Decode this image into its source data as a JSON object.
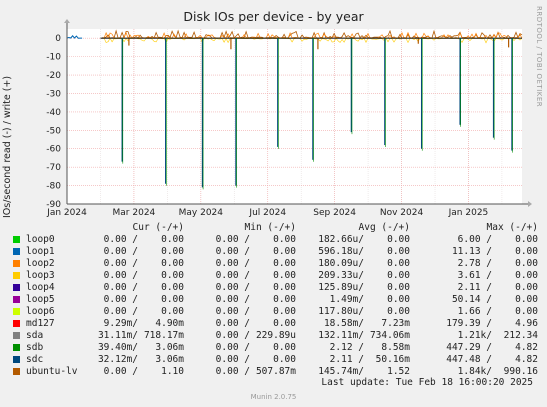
{
  "title": "Disk IOs per device - by year",
  "ylabel": "IOs/second read (-) / write (+)",
  "watermark": "RRDTOOL / TOBI OETIKER",
  "chart_data": {
    "type": "line",
    "title": "Disk IOs per device - by year",
    "ylabel": "IOs/second read (-) / write (+)",
    "xlabel": "",
    "ylim": [
      -90,
      5
    ],
    "yticks": [
      0,
      -10,
      -20,
      -30,
      -40,
      -50,
      -60,
      -70,
      -80,
      -90
    ],
    "xticks": [
      "Jan 2024",
      "Mar 2024",
      "May 2024",
      "Jul 2024",
      "Sep 2024",
      "Nov 2024",
      "Jan 2025"
    ],
    "xlim_months": [
      0,
      13.6
    ],
    "grid": true,
    "read_spikes": [
      {
        "month": 1.65,
        "value": -67
      },
      {
        "month": 2.95,
        "value": -79
      },
      {
        "month": 4.05,
        "value": -81
      },
      {
        "month": 5.05,
        "value": -80
      },
      {
        "month": 6.3,
        "value": -59
      },
      {
        "month": 7.35,
        "value": -66
      },
      {
        "month": 8.5,
        "value": -51
      },
      {
        "month": 9.5,
        "value": -58
      },
      {
        "month": 10.6,
        "value": -60
      },
      {
        "month": 11.75,
        "value": -47
      },
      {
        "month": 12.75,
        "value": -54
      },
      {
        "month": 13.3,
        "value": -61
      }
    ],
    "series": [
      {
        "name": "loop0",
        "color": "#00cc00"
      },
      {
        "name": "loop1",
        "color": "#0066b3"
      },
      {
        "name": "loop2",
        "color": "#ff8000"
      },
      {
        "name": "loop3",
        "color": "#ffcc00"
      },
      {
        "name": "loop4",
        "color": "#330099"
      },
      {
        "name": "loop5",
        "color": "#990099"
      },
      {
        "name": "loop6",
        "color": "#ccff00"
      },
      {
        "name": "md127",
        "color": "#ff0000"
      },
      {
        "name": "sda",
        "color": "#808080"
      },
      {
        "name": "sdb",
        "color": "#008f00"
      },
      {
        "name": "sdc",
        "color": "#00487d"
      },
      {
        "name": "ubuntu-lv",
        "color": "#b35a00"
      }
    ]
  },
  "legend": {
    "headers": {
      "cur": "Cur (-/+)",
      "min": "Min (-/+)",
      "avg": "Avg (-/+)",
      "max": "Max (-/+)"
    },
    "rows": [
      {
        "name": "loop0",
        "color": "#00cc00",
        "cur_r": "0.00 /",
        "cur_w": "0.00",
        "min_r": "0.00 /",
        "min_w": "0.00",
        "avg_r": "182.66u/",
        "avg_w": "0.00",
        "max_r": "6.00 /",
        "max_w": "0.00"
      },
      {
        "name": "loop1",
        "color": "#0066b3",
        "cur_r": "0.00 /",
        "cur_w": "0.00",
        "min_r": "0.00 /",
        "min_w": "0.00",
        "avg_r": "596.18u/",
        "avg_w": "0.00",
        "max_r": "11.13 /",
        "max_w": "0.00"
      },
      {
        "name": "loop2",
        "color": "#ff8000",
        "cur_r": "0.00 /",
        "cur_w": "0.00",
        "min_r": "0.00 /",
        "min_w": "0.00",
        "avg_r": "180.09u/",
        "avg_w": "0.00",
        "max_r": "2.78 /",
        "max_w": "0.00"
      },
      {
        "name": "loop3",
        "color": "#ffcc00",
        "cur_r": "0.00 /",
        "cur_w": "0.00",
        "min_r": "0.00 /",
        "min_w": "0.00",
        "avg_r": "209.33u/",
        "avg_w": "0.00",
        "max_r": "3.61 /",
        "max_w": "0.00"
      },
      {
        "name": "loop4",
        "color": "#330099",
        "cur_r": "0.00 /",
        "cur_w": "0.00",
        "min_r": "0.00 /",
        "min_w": "0.00",
        "avg_r": "125.89u/",
        "avg_w": "0.00",
        "max_r": "2.11 /",
        "max_w": "0.00"
      },
      {
        "name": "loop5",
        "color": "#990099",
        "cur_r": "0.00 /",
        "cur_w": "0.00",
        "min_r": "0.00 /",
        "min_w": "0.00",
        "avg_r": "1.49m/",
        "avg_w": "0.00",
        "max_r": "50.14 /",
        "max_w": "0.00"
      },
      {
        "name": "loop6",
        "color": "#ccff00",
        "cur_r": "0.00 /",
        "cur_w": "0.00",
        "min_r": "0.00 /",
        "min_w": "0.00",
        "avg_r": "117.80u/",
        "avg_w": "0.00",
        "max_r": "1.66 /",
        "max_w": "0.00"
      },
      {
        "name": "md127",
        "color": "#ff0000",
        "cur_r": "9.29m/",
        "cur_w": "4.90m",
        "min_r": "0.00 /",
        "min_w": "0.00",
        "avg_r": "18.58m/",
        "avg_w": "7.23m",
        "max_r": "179.39 /",
        "max_w": "4.96"
      },
      {
        "name": "sda",
        "color": "#808080",
        "cur_r": "31.11m/",
        "cur_w": "718.17m",
        "min_r": "0.00 /",
        "min_w": "229.89u",
        "avg_r": "132.11m/",
        "avg_w": "734.06m",
        "max_r": "1.21k/",
        "max_w": "212.34"
      },
      {
        "name": "sdb",
        "color": "#008f00",
        "cur_r": "39.40m/",
        "cur_w": "3.06m",
        "min_r": "0.00 /",
        "min_w": "0.00",
        "avg_r": "2.12 /",
        "avg_w": "8.58m",
        "max_r": "447.29 /",
        "max_w": "4.82"
      },
      {
        "name": "sdc",
        "color": "#00487d",
        "cur_r": "32.12m/",
        "cur_w": "3.06m",
        "min_r": "0.00 /",
        "min_w": "0.00",
        "avg_r": "2.11 /",
        "avg_w": "50.16m",
        "max_r": "447.48 /",
        "max_w": "4.82"
      },
      {
        "name": "ubuntu-lv",
        "color": "#b35a00",
        "cur_r": "0.00 /",
        "cur_w": "1.10",
        "min_r": "0.00 /",
        "min_w": "507.87m",
        "avg_r": "145.74m/",
        "avg_w": "1.52",
        "max_r": "1.84k/",
        "max_w": "990.16"
      }
    ]
  },
  "last_update": "Last update: Tue Feb 18 16:00:20 2025",
  "footer": "Munin 2.0.75"
}
